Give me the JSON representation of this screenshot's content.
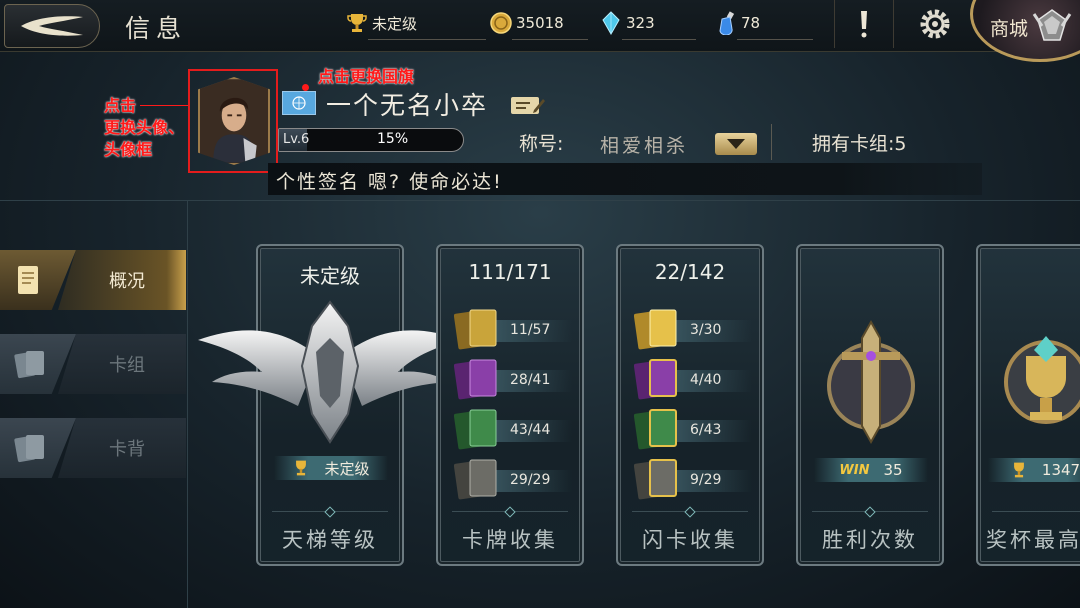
{
  "header": {
    "title": "信息",
    "rank": "未定级",
    "gold": "35018",
    "gems": "323",
    "potions": "78",
    "shop_label": "商城"
  },
  "profile": {
    "name": "一个无名小卒",
    "level": "Lv.6",
    "exp_percent": "15%",
    "exp_fraction": 0.15,
    "title_label": "称号:",
    "title_value": "相爱相杀",
    "deck_count": "拥有卡组:5",
    "signature": "个性签名  嗯? 使命必达!"
  },
  "annotations": {
    "avatar_hint": "点击\n更换头像、\n头像框",
    "flag_hint": "点击更换国旗"
  },
  "sidebar": {
    "items": [
      {
        "label": "概况",
        "active": true
      },
      {
        "label": "卡组",
        "active": false
      },
      {
        "label": "卡背",
        "active": false
      }
    ]
  },
  "cards": {
    "ladder": {
      "head": "未定级",
      "badge": "未定级",
      "foot": "天梯等级"
    },
    "collection": {
      "head": "111/171",
      "rows": [
        "11/57",
        "28/41",
        "43/44",
        "29/29"
      ],
      "foot": "卡牌收集"
    },
    "foil": {
      "head": "22/142",
      "rows": [
        "3/30",
        "4/40",
        "6/43",
        "9/29"
      ],
      "foot": "闪卡收集"
    },
    "wins": {
      "win_tag": "WIN",
      "value": "35",
      "foot": "胜利次数"
    },
    "trophy": {
      "value": "1347",
      "foot": "奖杯最高"
    }
  },
  "colors": {
    "accent_gold": "#c8a04b",
    "annotation_red": "#ff1a1a",
    "legendary": "#c9a43a",
    "epic": "#8a3fa8",
    "rare": "#3f8a4a",
    "common": "#6c6c66"
  }
}
